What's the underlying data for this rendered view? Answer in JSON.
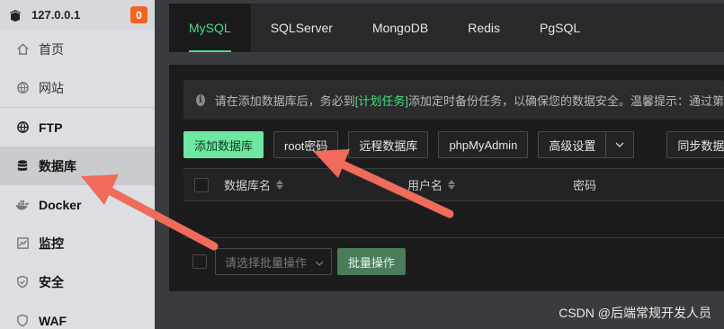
{
  "sidebar": {
    "host": "127.0.0.1",
    "badge": "0",
    "items": [
      {
        "label": "首页",
        "icon": "home-icon"
      },
      {
        "label": "网站",
        "icon": "globe-icon"
      },
      {
        "label": "FTP",
        "icon": "ftp-globe-icon"
      },
      {
        "label": "数据库",
        "icon": "database-icon"
      },
      {
        "label": "Docker",
        "icon": "docker-icon"
      },
      {
        "label": "监控",
        "icon": "monitor-icon"
      },
      {
        "label": "安全",
        "icon": "shield-icon"
      },
      {
        "label": "WAF",
        "icon": "waf-icon"
      }
    ]
  },
  "tabs": [
    "MySQL",
    "SQLServer",
    "MongoDB",
    "Redis",
    "PgSQL"
  ],
  "active_tab": "MySQL",
  "notice": {
    "before": "请在添加数据库后，务必到",
    "link": "[计划任务]",
    "after": "添加定时备份任务，以确保您的数据安全。温馨提示：通过第"
  },
  "toolbar": {
    "add_db": "添加数据库",
    "root_pwd": "root密码",
    "remote_db": "远程数据库",
    "phpmyadmin": "phpMyAdmin",
    "advanced": "高级设置",
    "sync_db": "同步数据库"
  },
  "table": {
    "headers": [
      "数据库名",
      "用户名",
      "密码"
    ]
  },
  "footer": {
    "batch_placeholder": "请选择批量操作",
    "batch_button": "批量操作"
  },
  "watermark": "CSDN @后端常规开发人员",
  "colors": {
    "accent": "#4ade80",
    "arrow": "#f06b5b",
    "badge": "#f26322"
  }
}
